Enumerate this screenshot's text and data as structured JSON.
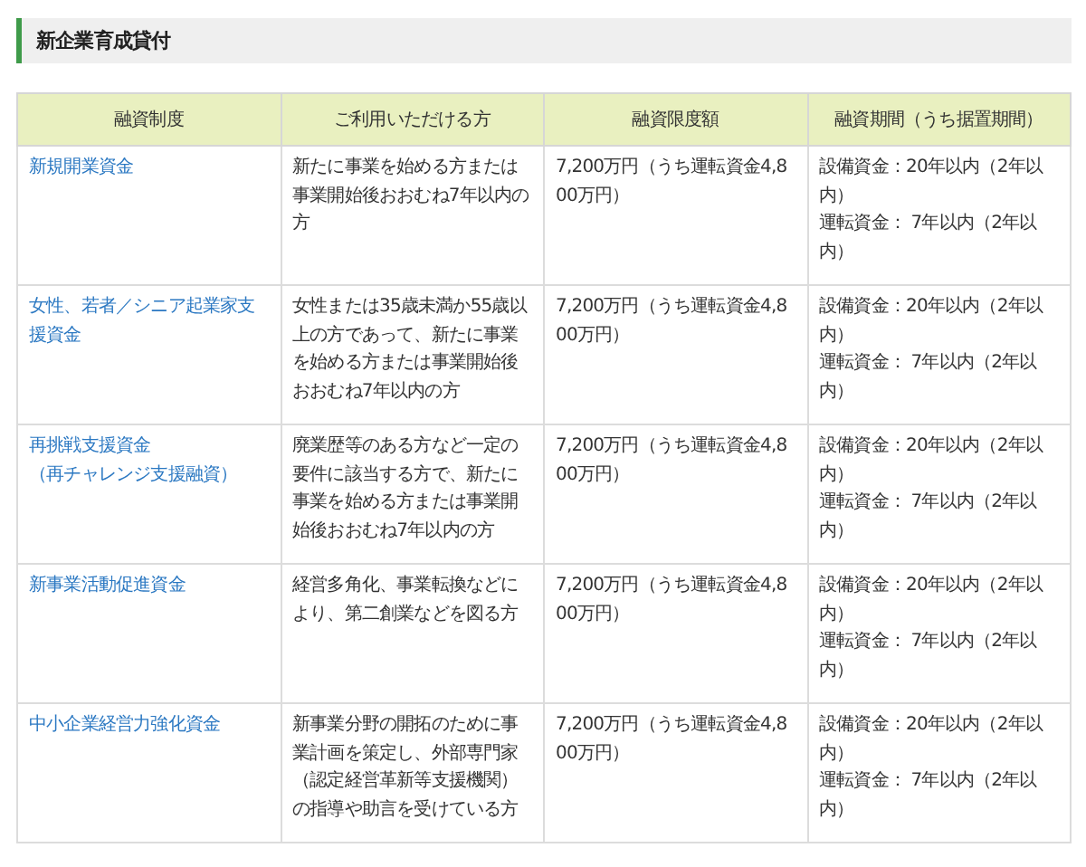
{
  "heading": "新企業育成貸付",
  "table": {
    "columns": [
      "融資制度",
      "ご利用いただける方",
      "融資限度額",
      "融資期間（うち据置期間）"
    ],
    "rows": [
      {
        "program": "新規開業資金",
        "eligible": "新たに事業を始める方または事業開始後おおむね7年以内の方",
        "limit": "7,200万円（うち運転資金4,800万円）",
        "terms": [
          "設備資金：20年以内（2年以内）",
          "運転資金： 7年以内（2年以内）"
        ]
      },
      {
        "program": "女性、若者／シニア起業家支援資金",
        "eligible": "女性または35歳未満か55歳以上の方であって、新たに事業を始める方または事業開始後おおむね7年以内の方",
        "limit": "7,200万円（うち運転資金4,800万円）",
        "terms": [
          "設備資金：20年以内（2年以内）",
          "運転資金： 7年以内（2年以内）"
        ]
      },
      {
        "program": "再挑戦支援資金",
        "program_note": "（再チャレンジ支援融資）",
        "eligible": "廃業歴等のある方など一定の要件に該当する方で、新たに事業を始める方または事業開始後おおむね7年以内の方",
        "limit": "7,200万円（うち運転資金4,800万円）",
        "terms": [
          "設備資金：20年以内（2年以内）",
          "運転資金： 7年以内（2年以内）"
        ]
      },
      {
        "program": "新事業活動促進資金",
        "eligible": "経営多角化、事業転換などにより、第二創業などを図る方",
        "limit": "7,200万円（うち運転資金4,800万円）",
        "terms": [
          "設備資金：20年以内（2年以内）",
          "運転資金： 7年以内（2年以内）"
        ]
      },
      {
        "program": "中小企業経営力強化資金",
        "eligible": "新事業分野の開拓のために事業計画を策定し、外部専門家（認定経営革新等支援機関）の指導や助言を受けている方",
        "limit": "7,200万円（うち運転資金4,800万円）",
        "terms": [
          "設備資金：20年以内（2年以内）",
          "運転資金： 7年以内（2年以内）"
        ]
      }
    ]
  }
}
